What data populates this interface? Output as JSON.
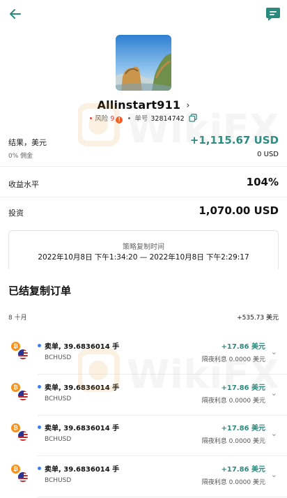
{
  "header": {
    "back_icon": "arrow-left-icon",
    "chat_icon": "chat-bubble-icon",
    "accent": "#2b8a7e"
  },
  "profile": {
    "name": "Allinstart911",
    "risk_label": "风险",
    "risk_value": "9",
    "risk_badge": "!",
    "order_label": "单号",
    "order_number": "32814742"
  },
  "stats": {
    "result_label": "结果，美元",
    "result_value": "+1,115.67 USD",
    "commission_label": "0% 佣金",
    "commission_value": "0 USD",
    "yield_label": "收益水平",
    "yield_value": "104%",
    "investment_label": "投资",
    "investment_value": "1,070.00 USD"
  },
  "period": {
    "title": "策略复制时间",
    "range": "2022年10月8日 下午1:34:20 — 2022年10月8日 下午2:29:17"
  },
  "closed_orders": {
    "title": "已结复制订单",
    "month_label": "8 十月",
    "month_total": "+535.73 美元",
    "items": [
      {
        "title": "卖单, 39.6836014 手",
        "symbol": "BCHUSD",
        "profit": "+17.86 美元",
        "swap": "隔夜利息 0.0000 美元"
      },
      {
        "title": "卖单, 39.6836014 手",
        "symbol": "BCHUSD",
        "profit": "+17.86 美元",
        "swap": "隔夜利息 0.0000 美元"
      },
      {
        "title": "卖单, 39.6836014 手",
        "symbol": "BCHUSD",
        "profit": "+17.86 美元",
        "swap": "隔夜利息 0.0000 美元"
      },
      {
        "title": "卖单, 39.6836014 手",
        "symbol": "BCHUSD",
        "profit": "+17.86 美元",
        "swap": "隔夜利息 0.0000 美元"
      }
    ]
  },
  "watermark": {
    "text": "WikiFX"
  },
  "glyphs": {
    "chevron_right": "›",
    "chevron_down": "⌄",
    "btc": "₿"
  }
}
